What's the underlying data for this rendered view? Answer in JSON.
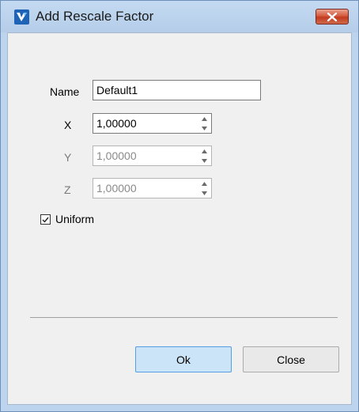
{
  "window": {
    "title": "Add Rescale Factor",
    "close_icon": "close-icon",
    "app_icon": "app-logo-icon"
  },
  "form": {
    "name_label": "Name",
    "name_value": "Default1",
    "x_label": "X",
    "x_value": "1,00000",
    "y_label": "Y",
    "y_value": "1,00000",
    "z_label": "Z",
    "z_value": "1,00000",
    "uniform_label": "Uniform",
    "uniform_checked": true
  },
  "buttons": {
    "ok_label": "Ok",
    "close_label": "Close"
  },
  "colors": {
    "titlebar": "#bcd4ee",
    "client_bg": "#f0f0f0",
    "ok_bg": "#cce4f7",
    "close_btn": "#c23b20"
  }
}
